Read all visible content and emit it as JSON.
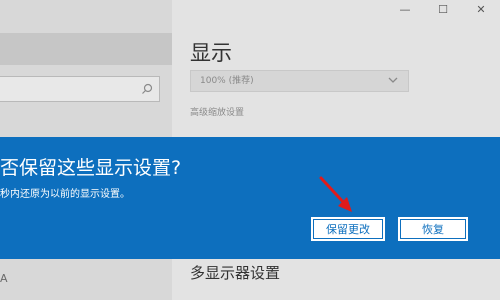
{
  "window": {
    "minimize_glyph": "—",
    "maximize_glyph": "☐",
    "close_glyph": "✕"
  },
  "sidebar": {
    "footer_text": "A"
  },
  "main": {
    "section_title": "显示",
    "scale_dropdown": {
      "value": "100% (推荐)"
    },
    "advanced_scaling_link": "高级缩放设置",
    "multi_display_title": "多显示器设置"
  },
  "dialog": {
    "title": "否保留这些显示设置?",
    "message": "秒内还原为以前的显示设置。",
    "keep_button": "保留更改",
    "revert_button": "恢复"
  },
  "annotation": {
    "arrow_color": "#e01b1b"
  },
  "colors": {
    "dialog_background": "#0d6fbe",
    "button_text": "#0d6fbe"
  }
}
